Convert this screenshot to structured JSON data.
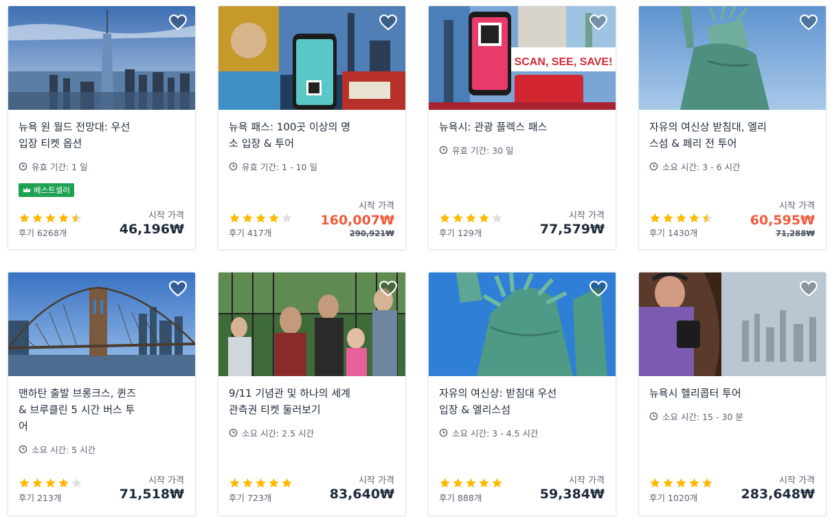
{
  "colors": {
    "accent_sale": "#ef5a3b",
    "badge_green": "#1da152",
    "star": "#ffb800",
    "star_empty": "#dcdfe3"
  },
  "cards": [
    {
      "title_l1": "뉴욕 원 월드 전망대: 우선",
      "title_l2": "입장 티켓 옵션",
      "title_l3": "",
      "meta_label": "유효 기간: 1 일",
      "badge": "베스트셀러",
      "rating": 4.5,
      "reviews": "후기 6268개",
      "from": "시작 가격",
      "price": "46,196₩",
      "original_price": "",
      "icon": "clock-icon"
    },
    {
      "title_l1": "뉴욕 패스: 100곳 이상의 명",
      "title_l2": "소 입장 & 투어",
      "title_l3": "",
      "meta_label": "유효 기간: 1 - 10 일",
      "badge": "",
      "rating": 4,
      "reviews": "후기 417개",
      "from": "시작 가격",
      "price": "160,007₩",
      "original_price": "290,921₩",
      "icon": "clock-icon"
    },
    {
      "title_l1": "뉴욕시: 관광 플렉스 패스",
      "title_l2": "",
      "title_l3": "",
      "meta_label": "유효 기간: 30 일",
      "badge": "",
      "rating": 4,
      "reviews": "후기 129개",
      "from": "시작 가격",
      "price": "77,579₩",
      "original_price": "",
      "icon": "clock-icon"
    },
    {
      "title_l1": "자유의 여신상 받침대, 엘리",
      "title_l2": "스섬 & 페리 전 투어",
      "title_l3": "",
      "meta_label": "소요 시간: 3 - 6 시간",
      "badge": "",
      "rating": 4.5,
      "reviews": "후기 1430개",
      "from": "시작 가격",
      "price": "60,595₩",
      "original_price": "71,288₩",
      "icon": "clock-icon"
    },
    {
      "title_l1": "맨하탄 출발 브롱크스, 퀸즈",
      "title_l2": "& 브루클린 5 시간 버스 투",
      "title_l3": "어",
      "meta_label": "소요 시간: 5 시간",
      "badge": "",
      "rating": 4,
      "reviews": "후기 213개",
      "from": "시작 가격",
      "price": "71,518₩",
      "original_price": "",
      "icon": "clock-icon"
    },
    {
      "title_l1": "9/11 기념관 및 하나의 세계",
      "title_l2": "관측권 티켓 둘러보기",
      "title_l3": "",
      "meta_label": "소요 시간: 2.5 시간",
      "badge": "",
      "rating": 5,
      "reviews": "후기 723개",
      "from": "시작 가격",
      "price": "83,640₩",
      "original_price": "",
      "icon": "clock-icon"
    },
    {
      "title_l1": "자유의 여신상: 받침대 우선",
      "title_l2": "입장 & 엘리스섬",
      "title_l3": "",
      "meta_label": "소요 시간: 3 - 4.5 시간",
      "badge": "",
      "rating": 5,
      "reviews": "후기 888개",
      "from": "시작 가격",
      "price": "59,384₩",
      "original_price": "",
      "icon": "clock-icon"
    },
    {
      "title_l1": "뉴욕시 헬리콥터 투어",
      "title_l2": "",
      "title_l3": "",
      "meta_label": "소요 시간: 15 - 30 분",
      "badge": "",
      "rating": 5,
      "reviews": "후기 1020개",
      "from": "시작 가격",
      "price": "283,648₩",
      "original_price": "",
      "icon": "clock-icon"
    }
  ]
}
